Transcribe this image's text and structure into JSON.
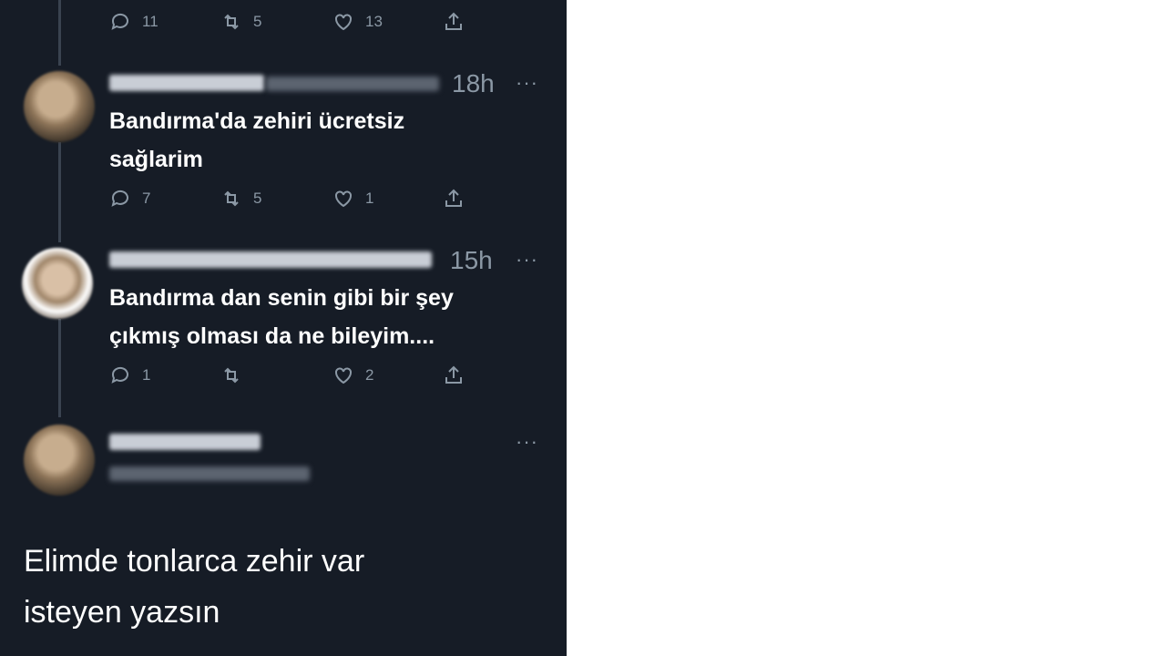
{
  "top_actions": {
    "replies": "11",
    "retweets": "5",
    "likes": "13"
  },
  "replies": [
    {
      "time": "18h",
      "text_line1": "Bandırma'da zehiri ücretsiz",
      "text_line2": "sağlarim",
      "actions": {
        "replies": "7",
        "retweets": "5",
        "likes": "1"
      }
    },
    {
      "time": "15h",
      "text_line1": "Bandırma dan senin gibi bir şey",
      "text_line2": "çıkmış olması da ne bileyim....",
      "actions": {
        "replies": "1",
        "retweets": "",
        "likes": "2"
      }
    }
  ],
  "main_tweet": {
    "more": "···",
    "text_line1": "Elimde tonlarca zehir var",
    "text_line2": "isteyen yazsın"
  },
  "more_label": "···",
  "colors": {
    "background": "#161c26",
    "text": "#ffffff",
    "muted": "#8b98a5",
    "thread": "#3a4350"
  },
  "icons": [
    "reply-icon",
    "retweet-icon",
    "like-icon",
    "share-icon",
    "more-icon"
  ]
}
